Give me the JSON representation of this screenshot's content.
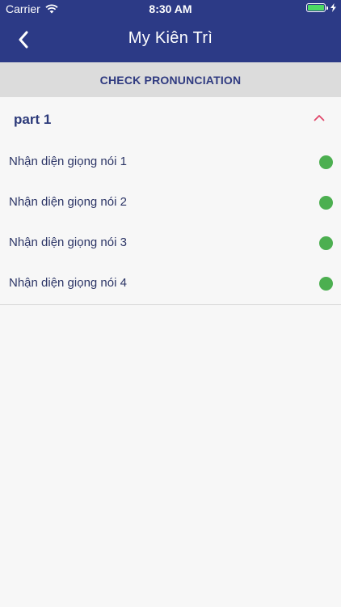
{
  "status_bar": {
    "carrier": "Carrier",
    "time": "8:30 AM",
    "wifi_icon": "wifi-icon",
    "battery_icon": "battery-full-icon",
    "charging_icon": "charging-bolt-icon"
  },
  "nav": {
    "title": "My Kiên Trì",
    "back_icon": "chevron-left-icon"
  },
  "section": {
    "label": "CHECK PRONUNCIATION"
  },
  "part": {
    "title": "part 1",
    "expanded": true,
    "chevron_icon": "chevron-up-icon",
    "items": [
      {
        "label": "Nhận diện giọng nói 1",
        "status": "complete"
      },
      {
        "label": "Nhận diện giọng nói 2",
        "status": "complete"
      },
      {
        "label": "Nhận diện giọng nói 3",
        "status": "complete"
      },
      {
        "label": "Nhận diện giọng nói 4",
        "status": "complete"
      }
    ]
  },
  "colors": {
    "nav_background": "#2c3a86",
    "section_background": "#dcdcdc",
    "accent_text": "#2f3a80",
    "chevron": "#e0466a",
    "status_complete": "#4caf50",
    "battery_fill": "#4cd964"
  }
}
